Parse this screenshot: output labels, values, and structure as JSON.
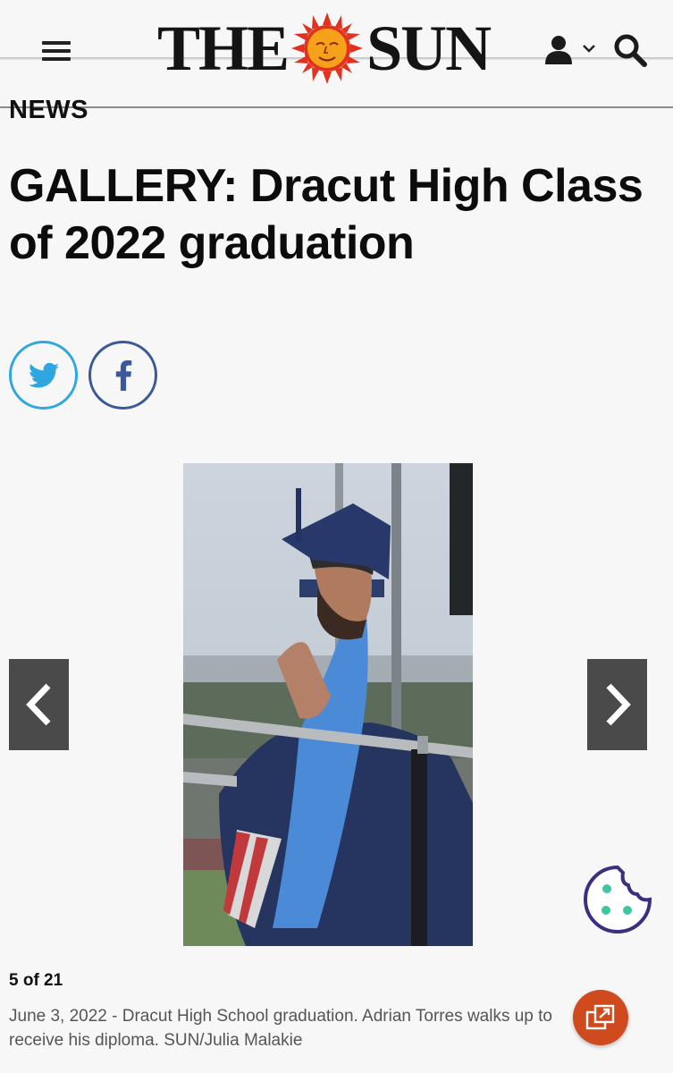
{
  "header": {
    "logo_left": "THE",
    "logo_right": "SUN",
    "menu_icon": "hamburger-menu-icon",
    "account_icon": "user-icon",
    "search_icon": "search-icon"
  },
  "section": {
    "label": "NEWS"
  },
  "article": {
    "title": "GALLERY: Dracut High Class of 2022 graduation"
  },
  "share": {
    "twitter_icon": "twitter-bird-icon",
    "facebook_icon": "facebook-f-icon",
    "twitter_color": "#2ea7e0",
    "facebook_color": "#3b5998"
  },
  "gallery": {
    "counter": "5 of 21",
    "caption": "June 3, 2022 - Dracut High School graduation. Adrian Torres walks up to receive his diploma. SUN/Julia Malakie",
    "prev_icon": "chevron-left-icon",
    "next_icon": "chevron-right-icon"
  },
  "colors": {
    "background": "#f7f7f8",
    "nav_arrow_bg": "#4a4a4a",
    "expand_button": "#cf4a1d",
    "cookie_outline": "#3d2f80",
    "cookie_dots": "#3ec6a1"
  }
}
